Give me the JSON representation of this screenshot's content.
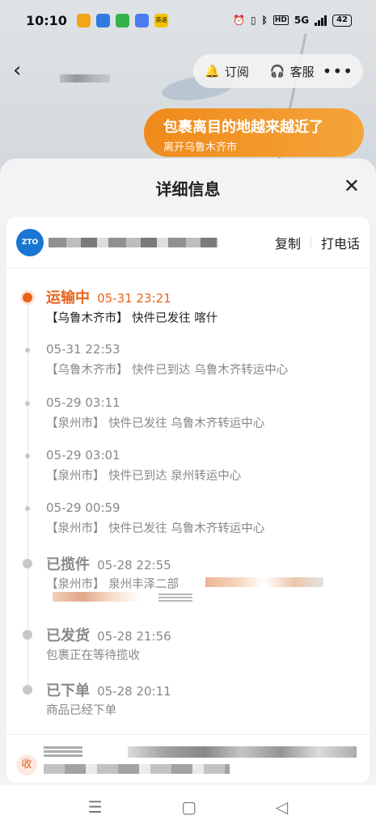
{
  "status_bar": {
    "time": "10:10",
    "app_icon_colors": [
      "#f3a41b",
      "#2f7be0",
      "#33b34a",
      "#4c7cf0",
      "#f5c400"
    ],
    "app_icon_label": "英语",
    "battery": "42",
    "network": "5G"
  },
  "nav": {
    "back_icon": "chevron-left-icon",
    "subscribe_label": "订阅",
    "service_label": "客服",
    "more_icon": "more-dots-icon"
  },
  "banner": {
    "title": "包裹离目的地越来越近了",
    "subtitle": "离开乌鲁木齐市"
  },
  "sheet": {
    "title": "详细信息",
    "close_icon": "close-icon"
  },
  "courier": {
    "logo_text": "ZTO",
    "copy_label": "复制",
    "call_label": "打电话"
  },
  "events": [
    {
      "status": "运输中",
      "time": "05-31 23:21",
      "desc": "【乌鲁木齐市】 快件已发往 喀什",
      "active": true
    },
    {
      "status": "",
      "time": "05-31 22:53",
      "desc": "【乌鲁木齐市】 快件已到达 乌鲁木齐转运中心",
      "active": false
    },
    {
      "status": "",
      "time": "05-29 03:11",
      "desc": "【泉州市】 快件已发往 乌鲁木齐转运中心",
      "active": false
    },
    {
      "status": "",
      "time": "05-29 03:01",
      "desc": "【泉州市】 快件已到达 泉州转运中心",
      "active": false
    },
    {
      "status": "",
      "time": "05-29 00:59",
      "desc": "【泉州市】 快件已发往 乌鲁木齐转运中心",
      "active": false
    },
    {
      "status": "已揽件",
      "time": "05-28 22:55",
      "desc": "【泉州市】 泉州丰泽二部",
      "active": false
    },
    {
      "status": "已发货",
      "time": "05-28 21:56",
      "desc": "包裹正在等待揽收",
      "active": false
    },
    {
      "status": "已下单",
      "time": "05-28 20:11",
      "desc": "商品已经下单",
      "active": false
    }
  ],
  "receiver": {
    "badge": "收"
  },
  "colors": {
    "accent": "#e8631a",
    "muted": "#888888",
    "banner": "#f08a1a"
  }
}
